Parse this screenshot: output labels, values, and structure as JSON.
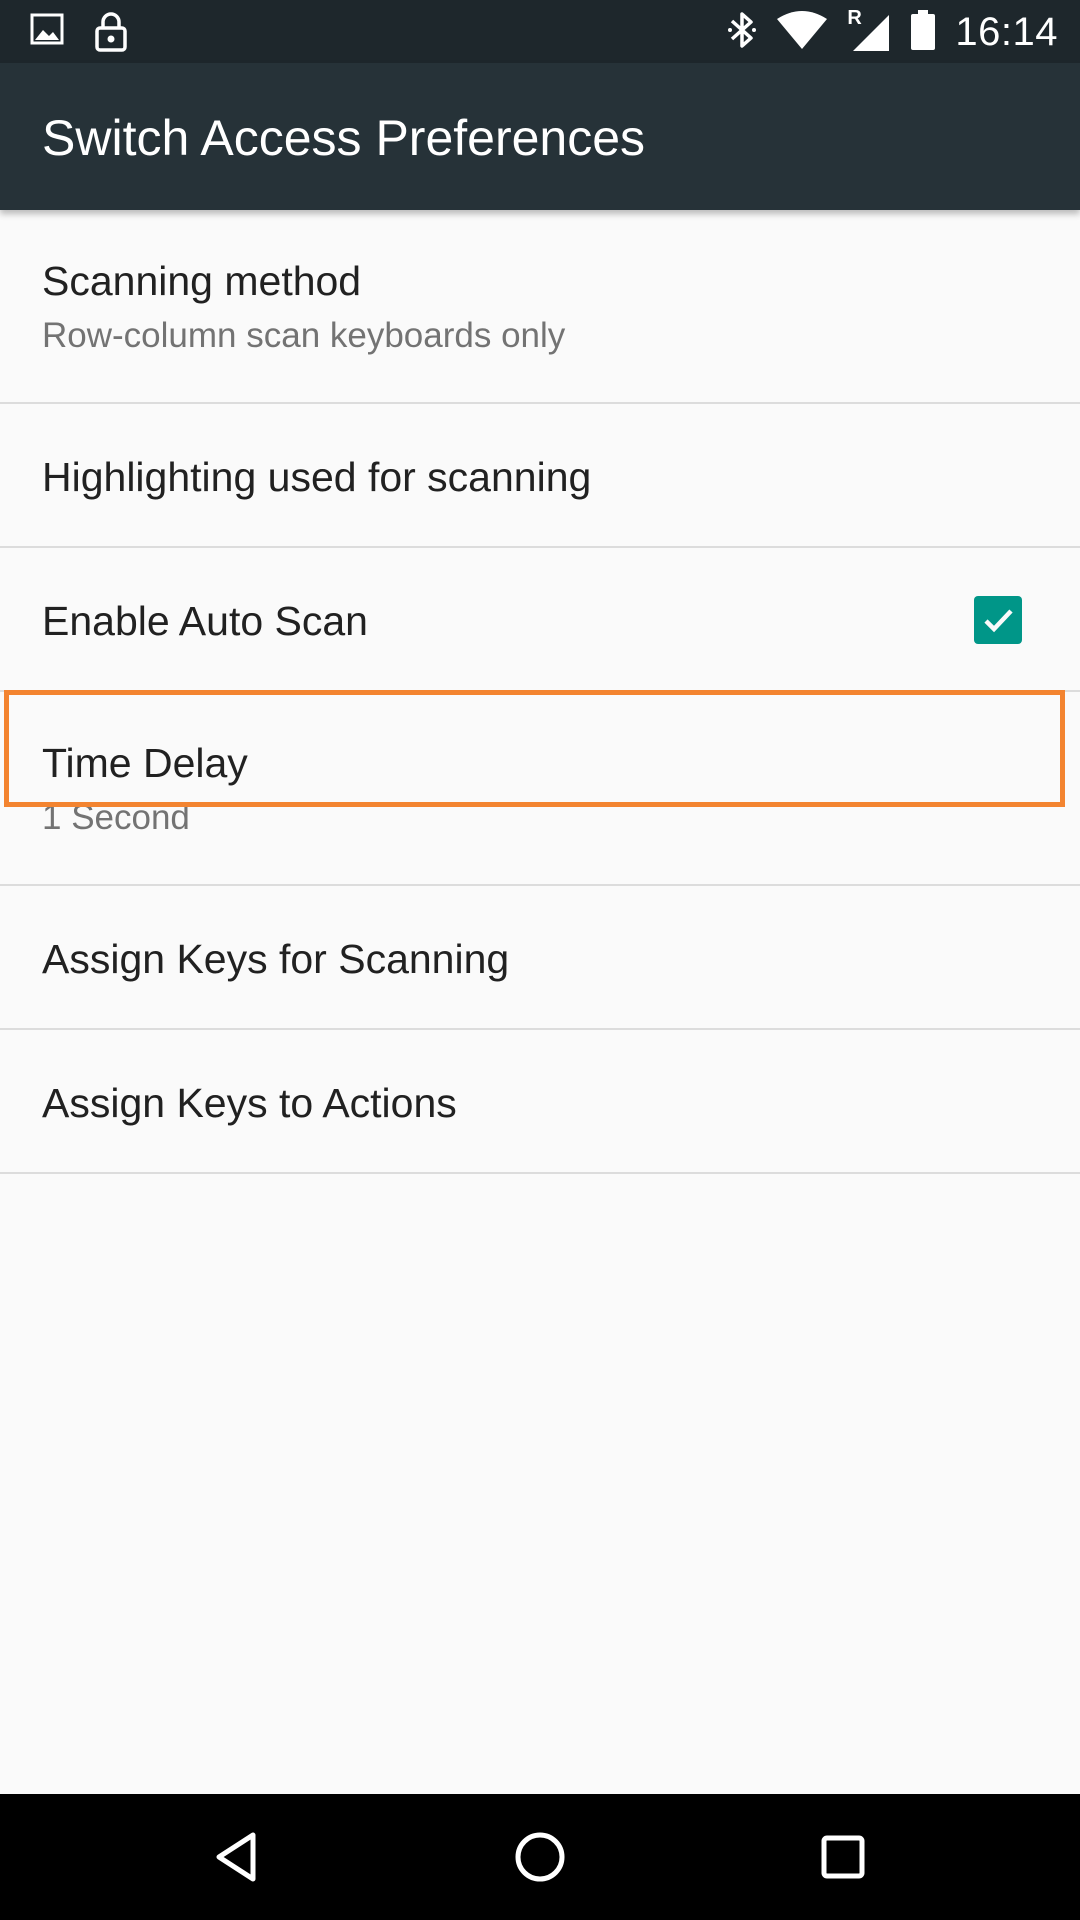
{
  "status_bar": {
    "time": "16:14",
    "icons_left": [
      "image-icon",
      "lock-icon"
    ],
    "icons_right": [
      "bluetooth-icon",
      "wifi-icon",
      "signal-roaming-icon",
      "battery-icon"
    ],
    "roaming_label": "R"
  },
  "app_bar": {
    "title": "Switch Access Preferences"
  },
  "preferences": [
    {
      "title": "Scanning method",
      "summary": "Row-column scan keyboards only"
    },
    {
      "title": "Highlighting used for scanning"
    },
    {
      "title": "Enable Auto Scan",
      "checked": true
    },
    {
      "title": "Time Delay",
      "summary": "1 Second"
    },
    {
      "title": "Assign Keys for Scanning",
      "focused": true
    },
    {
      "title": "Assign Keys to Actions"
    }
  ],
  "colors": {
    "status_bar": "#1e272c",
    "app_bar": "#263238",
    "accent": "#009688",
    "focus": "#f38430",
    "background": "#fafafa"
  },
  "nav_bar": {
    "buttons": [
      "back-icon",
      "home-icon",
      "recents-icon"
    ]
  }
}
